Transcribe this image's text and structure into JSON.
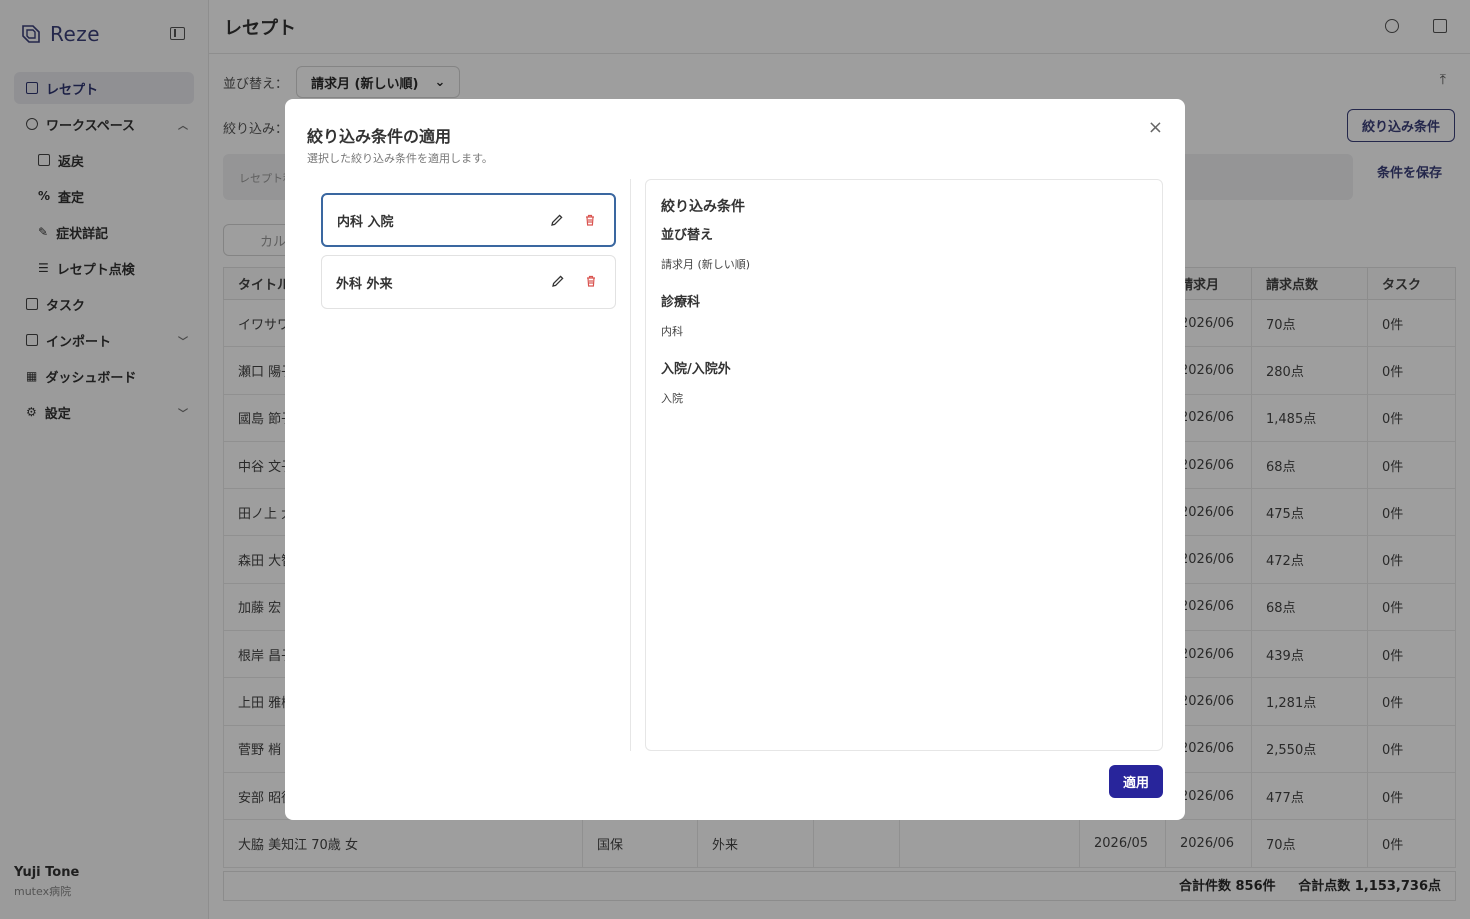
{
  "app": {
    "name": "Reze"
  },
  "sidebar": {
    "items": [
      {
        "label": "レセプト",
        "active": true
      },
      {
        "label": "ワークスペース",
        "expanded": true
      },
      {
        "label": "返戻",
        "sub": true
      },
      {
        "label": "査定",
        "sub": true
      },
      {
        "label": "症状詳記",
        "sub": true
      },
      {
        "label": "レセプト点検",
        "sub": true
      },
      {
        "label": "タスク"
      },
      {
        "label": "インポート",
        "expandable": true
      },
      {
        "label": "ダッシュボード"
      },
      {
        "label": "設定",
        "expandable": true
      }
    ],
    "user": {
      "name": "Yuji Tone",
      "org": "mutex病院"
    }
  },
  "main": {
    "title": "レセプト",
    "sort_label": "並び替え：",
    "sort_value": "請求月 (新しい順)",
    "filter_label": "絞り込み：",
    "filter_button": "絞り込み条件",
    "save_button": "条件を保存",
    "chips_placeholder": "レセプト種",
    "search_placeholder": "カル",
    "table": {
      "headers": [
        "タイトル",
        "",
        "",
        "",
        "",
        "",
        "請求月",
        "請求点数",
        "タスク"
      ],
      "rows": [
        [
          "イワサワ",
          "",
          "",
          "",
          "",
          "",
          "2026/06",
          "70点",
          "0件"
        ],
        [
          "瀬口 陽子",
          "",
          "",
          "",
          "",
          "",
          "2026/06",
          "280点",
          "0件"
        ],
        [
          "國島 節子",
          "",
          "",
          "",
          "",
          "",
          "2026/06",
          "1,485点",
          "0件"
        ],
        [
          "中谷 文子",
          "",
          "",
          "",
          "",
          "",
          "2026/06",
          "68点",
          "0件"
        ],
        [
          "田ノ上 大",
          "",
          "",
          "",
          "",
          "",
          "2026/06",
          "475点",
          "0件"
        ],
        [
          "森田 大智",
          "",
          "",
          "",
          "",
          "",
          "2026/06",
          "472点",
          "0件"
        ],
        [
          "加藤 宏",
          "",
          "",
          "",
          "",
          "",
          "2026/06",
          "68点",
          "0件"
        ],
        [
          "根岸 昌子",
          "",
          "",
          "",
          "",
          "",
          "2026/06",
          "439点",
          "0件"
        ],
        [
          "上田 雅樹",
          "",
          "",
          "",
          "",
          "",
          "2026/06",
          "1,281点",
          "0件"
        ],
        [
          "菅野 梢",
          "",
          "",
          "",
          "",
          "",
          "2026/06",
          "2,550点",
          "0件"
        ],
        [
          "安部 昭徳",
          "",
          "",
          "",
          "",
          "",
          "2026/06",
          "477点",
          "0件"
        ],
        [
          "大脇 美知江  70歳  女",
          "国保",
          "外来",
          "",
          "",
          "2026/05",
          "2026/06",
          "70点",
          "0件"
        ]
      ]
    },
    "totals": {
      "count": "合計件数 856件",
      "points": "合計点数 1,153,736点"
    }
  },
  "modal": {
    "title": "絞り込み条件の適用",
    "description": "選択した絞り込み条件を適用します。",
    "close": "×",
    "presets": [
      {
        "label": "内科 入院",
        "selected": true
      },
      {
        "label": "外科 外来",
        "selected": false
      }
    ],
    "detail": {
      "heading": "絞り込み条件",
      "sort_heading": "並び替え",
      "sort_value": "請求月 (新しい順)",
      "dept_heading": "診療科",
      "dept_value": "内科",
      "inout_heading": "入院/入院外",
      "inout_value": "入院"
    },
    "apply": "適用"
  },
  "colors": {
    "brand": "#3a3f7a",
    "apply": "#28259b",
    "selected_border": "#3a67a0",
    "trash": "#d9534f"
  }
}
